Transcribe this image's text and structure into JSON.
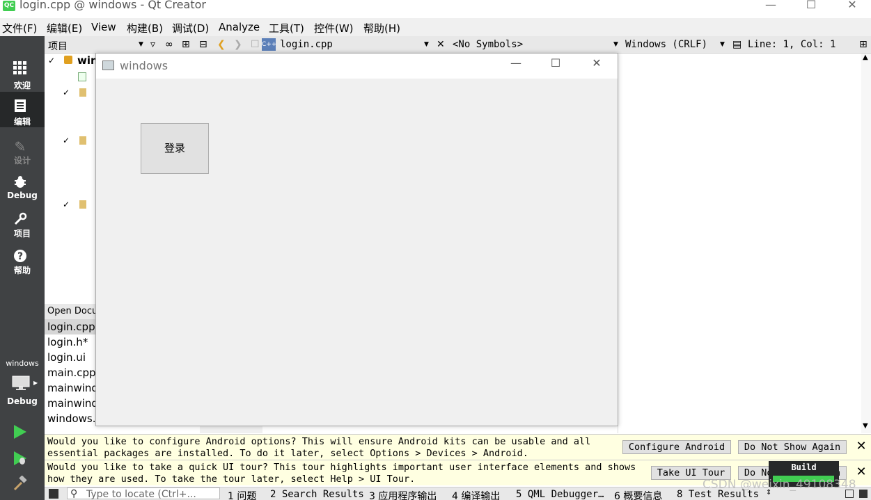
{
  "window": {
    "logo": "QC",
    "title": "login.cpp @ windows - Qt Creator",
    "minimize_icon": "minimize-icon",
    "maximize_icon": "maximize-icon",
    "close_icon": "close-icon"
  },
  "menubar": {
    "items": [
      "文件(F)",
      "编辑(E)",
      "View",
      "构建(B)",
      "调试(D)",
      "Analyze",
      "工具(T)",
      "控件(W)",
      "帮助(H)"
    ]
  },
  "modes": {
    "welcome": "欢迎",
    "edit": "编辑",
    "design": "设计",
    "debug": "Debug",
    "projects": "项目",
    "help": "帮助",
    "kit_project": "windows",
    "kit_mode": "Debug"
  },
  "toolbar": {
    "project_combo": "项目",
    "file_combo": "login.cpp",
    "symbols_combo": "<No Symbols>",
    "line_ending": "Windows (CRLF)",
    "position": "Line: 1, Col: 1"
  },
  "project_tree": {
    "root_label": "win"
  },
  "open_documents": {
    "header": "Open Documents",
    "files": [
      "login.cpp",
      "login.h*",
      "login.ui",
      "main.cpp",
      "mainwindow.cpp",
      "mainwindow.h",
      "windows.pro"
    ]
  },
  "dialog": {
    "title": "windows",
    "login_button": "登录"
  },
  "info_android": {
    "line1": "Would you like to configure Android options? This will ensure Android kits can be usable and all",
    "line2": "essential packages are installed. To do it later, select Options > Devices > Android.",
    "configure_button": "Configure Android",
    "dismiss_button": "Do Not Show Again"
  },
  "info_tour": {
    "line1": "Would you like to take a quick UI tour? This tour highlights important user interface elements and shows",
    "line2": "how they are used. To take the tour later, select Help > UI Tour.",
    "tour_button": "Take UI Tour",
    "dismiss_button": "Do Not Show Again"
  },
  "build_popup": {
    "label": "Build"
  },
  "statusbar": {
    "locator_placeholder": "Type to locate (Ctrl+...",
    "panes": [
      "1 问题",
      "2 Search Results",
      "3 应用程序输出",
      "4 编译输出",
      "5 QML Debugger…",
      "6 概要信息",
      "8 Test Results"
    ]
  },
  "watermark": "CSDN @weixin_49108348",
  "colors": {
    "sidebar": "#404244",
    "sidebar_active": "#262829",
    "infobar": "#ffffe1",
    "run_green": "#41cd52"
  }
}
